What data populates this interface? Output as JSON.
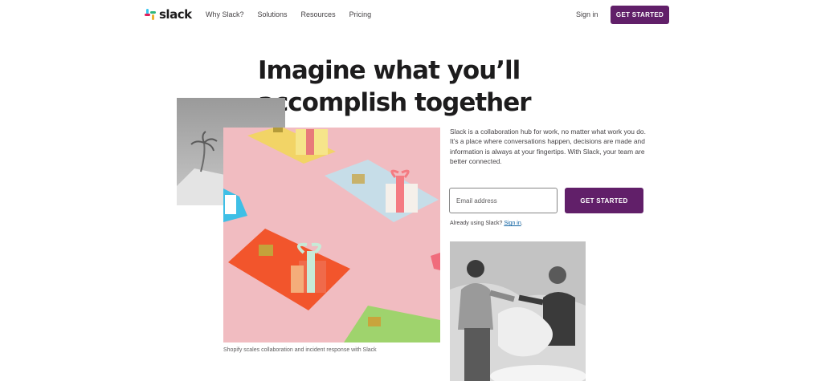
{
  "brand": {
    "name": "slack",
    "colors": {
      "aubergine": "#611f69",
      "blue": "#36c5f0",
      "green": "#2eb67d",
      "yellow": "#ecb22e",
      "red": "#e01e5a"
    }
  },
  "nav": {
    "links": [
      "Why Slack?",
      "Solutions",
      "Resources",
      "Pricing"
    ],
    "sign_in": "Sign in",
    "cta": "GET STARTED"
  },
  "hero": {
    "title_line1": "Imagine what you’ll",
    "title_line2": "accomplish together",
    "description": "Slack is a collaboration hub for work, no matter what work you do. It’s a place where conversations happen, decisions are made and information is always at your fingertips. With Slack, your team are better connected.",
    "email_placeholder": "Email address",
    "cta": "GET STARTED",
    "already_text": "Already using Slack?",
    "sign_in_link": "Sign in",
    "sign_in_suffix": "."
  },
  "images": {
    "caption": "Shopify scales collaboration and incident response with Slack"
  }
}
